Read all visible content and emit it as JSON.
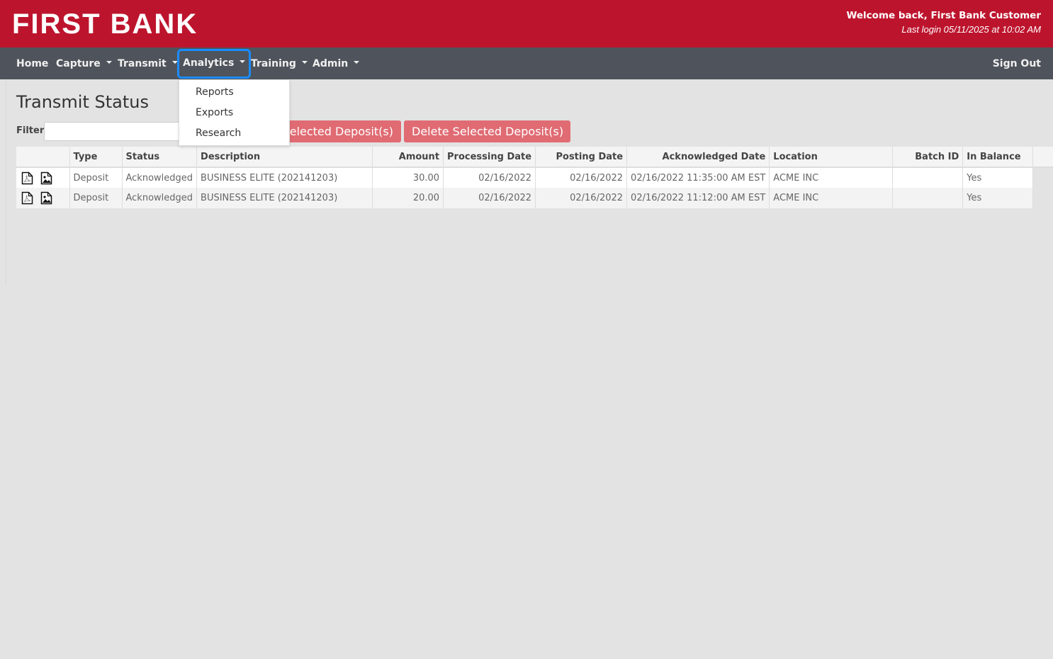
{
  "header": {
    "logo": "FIRST BANK",
    "welcome": "Welcome back, First Bank Customer",
    "last_login": "Last login 05/11/2025 at 10:02 AM",
    "brand_color": "#bd142d"
  },
  "nav": {
    "items": [
      {
        "label": "Home",
        "dropdown": false
      },
      {
        "label": "Capture",
        "dropdown": true
      },
      {
        "label": "Transmit",
        "dropdown": true
      },
      {
        "label": "Analytics",
        "dropdown": true,
        "active": true
      },
      {
        "label": "Training",
        "dropdown": true
      },
      {
        "label": "Admin",
        "dropdown": true
      }
    ],
    "sign_out": "Sign Out",
    "analytics_menu": [
      "Reports",
      "Exports",
      "Research"
    ]
  },
  "page": {
    "title": "Transmit Status",
    "filter_label": "Filter",
    "filter_value": "",
    "buttons": {
      "transmit_visible": "elected Deposit(s)",
      "delete": "Delete Selected Deposit(s)"
    }
  },
  "table": {
    "columns": [
      "",
      "Type",
      "Status",
      "Description",
      "Amount",
      "Processing Date",
      "Posting Date",
      "Acknowledged Date",
      "Location",
      "Batch ID",
      "In Balance"
    ],
    "rows": [
      {
        "type": "Deposit",
        "status": "Acknowledged",
        "description": "BUSINESS ELITE (202141203)",
        "amount": "30.00",
        "processing_date": "02/16/2022",
        "posting_date": "02/16/2022",
        "acknowledged_date": "02/16/2022 11:35:00 AM EST",
        "location": "ACME INC",
        "batch_id": "",
        "in_balance": "Yes",
        "icons": [
          "pdf-icon",
          "image-icon"
        ]
      },
      {
        "type": "Deposit",
        "status": "Acknowledged",
        "description": "BUSINESS ELITE (202141203)",
        "amount": "20.00",
        "processing_date": "02/16/2022",
        "posting_date": "02/16/2022",
        "acknowledged_date": "02/16/2022 11:12:00 AM EST",
        "location": "ACME INC",
        "batch_id": "",
        "in_balance": "Yes",
        "icons": [
          "pdf-icon",
          "image-icon"
        ]
      }
    ]
  }
}
